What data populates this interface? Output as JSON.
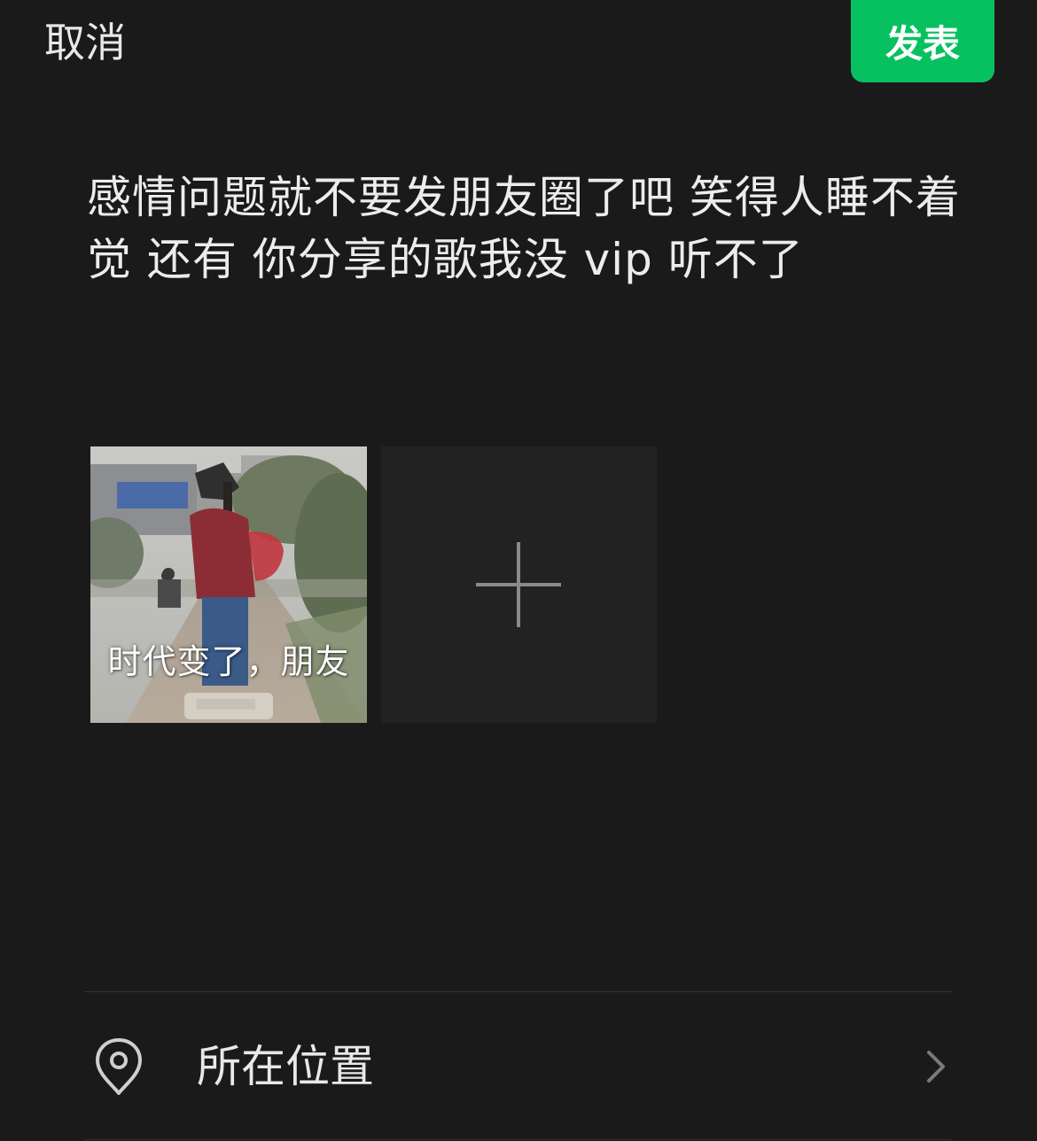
{
  "header": {
    "cancel_label": "取消",
    "publish_label": "发表"
  },
  "post": {
    "text": "感情问题就不要发朋友圈了吧 笑得人睡不着觉 还有 你分享的歌我没 vip 听不了"
  },
  "media": {
    "images": [
      {
        "caption": "时代变了，朋友"
      }
    ],
    "add_icon": "plus-icon"
  },
  "location": {
    "icon": "location-pin-icon",
    "label": "所在位置",
    "chevron_icon": "chevron-right-icon"
  },
  "colors": {
    "background": "#1a1a1a",
    "accent": "#07c160",
    "text": "#e8e8e8"
  }
}
